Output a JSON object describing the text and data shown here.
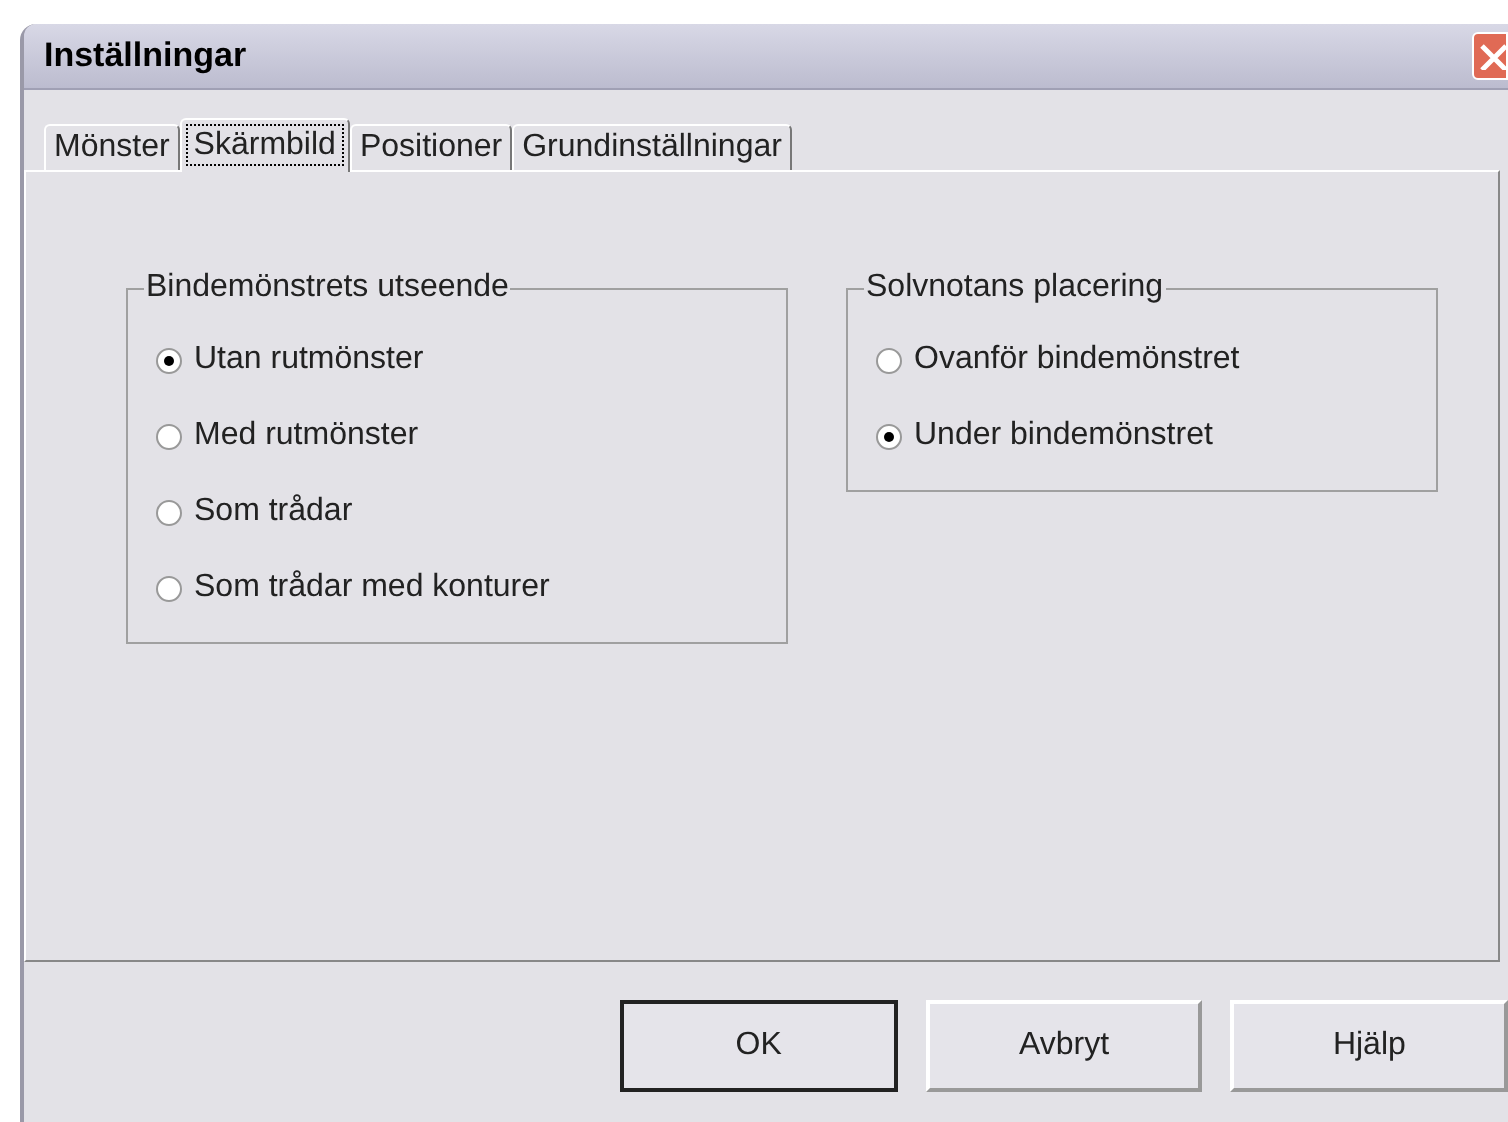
{
  "window": {
    "title": "Inställningar"
  },
  "tabs": [
    {
      "label": "Mönster",
      "selected": false
    },
    {
      "label": "Skärmbild",
      "selected": true
    },
    {
      "label": "Positioner",
      "selected": false
    },
    {
      "label": "Grundinställningar",
      "selected": false
    }
  ],
  "groups": [
    {
      "title": "Bindemönstrets utseende",
      "options": [
        {
          "label": "Utan rutmönster",
          "selected": true
        },
        {
          "label": "Med rutmönster",
          "selected": false
        },
        {
          "label": "Som trådar",
          "selected": false
        },
        {
          "label": "Som trådar med konturer",
          "selected": false
        }
      ]
    },
    {
      "title": "Solvnotans placering",
      "options": [
        {
          "label": "Ovanför bindemönstret",
          "selected": false
        },
        {
          "label": "Under bindemönstret",
          "selected": true
        }
      ]
    }
  ],
  "buttons": [
    {
      "label": "OK",
      "default": true
    },
    {
      "label": "Avbryt",
      "default": false
    },
    {
      "label": "Hjälp",
      "default": false
    }
  ]
}
